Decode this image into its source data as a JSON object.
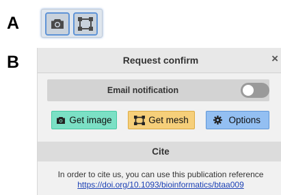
{
  "panel_labels": {
    "a": "A",
    "b": "B"
  },
  "toolbar": {
    "buttons": [
      {
        "icon": "camera-icon"
      },
      {
        "icon": "mesh-icon"
      }
    ]
  },
  "dialog": {
    "title": "Request confirm",
    "close_label": "×",
    "email_notification": {
      "label": "Email notification",
      "enabled": false
    },
    "buttons": [
      {
        "label": "Get image",
        "icon": "camera-icon",
        "color": "#7be0c5"
      },
      {
        "label": "Get mesh",
        "icon": "mesh-icon",
        "color": "#f6cf7a"
      },
      {
        "label": "Options",
        "icon": "gear-icon",
        "color": "#93bff2"
      }
    ],
    "cite": {
      "title": "Cite",
      "text": "In order to cite us, you can use this publication reference",
      "link": "https://doi.org/10.1093/bioinformatics/btaa009"
    }
  }
}
